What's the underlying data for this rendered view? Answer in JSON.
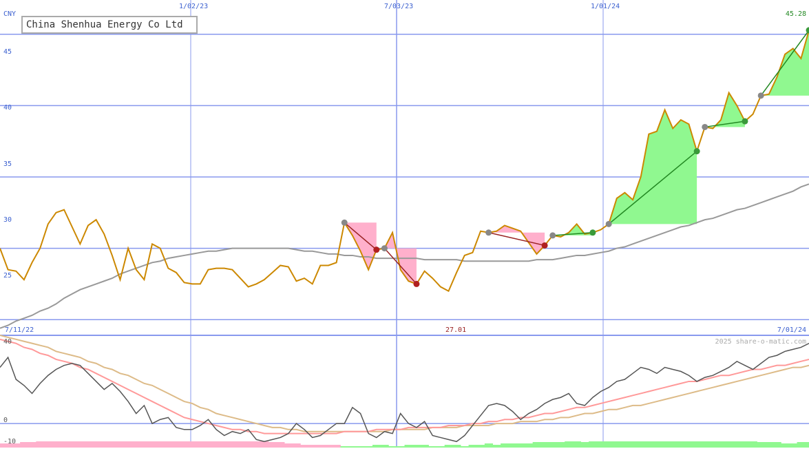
{
  "title": "China Shenhua Energy Co Ltd",
  "currency": "CNY",
  "last_price": "45.28",
  "mid_label": "27.01",
  "watermark": "2025 share-o-matic.com",
  "x_labels_top": [
    "1/02/23",
    "7/03/23",
    "1/01/24"
  ],
  "range_start": "7/11/22",
  "range_end": "7/01/24",
  "y_labels_price": [
    "45",
    "40",
    "35",
    "30",
    "25"
  ],
  "y_labels_osc": [
    "40",
    "0",
    "-10"
  ],
  "colors": {
    "price_line": "#cc8800",
    "moving_average": "#999999",
    "up_fill": "#90f890",
    "down_fill": "#ffb0cc",
    "gridline": "#8899ee",
    "up_trend": "#228822",
    "down_trend": "#992222",
    "osc_dark": "#555555",
    "osc_pink": "#ff9999",
    "osc_tan": "#ddbb88"
  },
  "chart_data": [
    {
      "type": "line",
      "title": "China Shenhua Energy Co Ltd",
      "ylabel": "CNY",
      "ylim": [
        23.9,
        47.4
      ],
      "x_ticks": [
        "1/02/23",
        "7/03/23",
        "1/01/24"
      ],
      "y_ticks": [
        25,
        30,
        35,
        40,
        45
      ],
      "grid": true,
      "series": [
        {
          "role": "price",
          "values": [
            30.0,
            28.5,
            28.4,
            27.8,
            29.0,
            30.0,
            31.7,
            32.5,
            32.7,
            31.5,
            30.3,
            31.6,
            32.0,
            31.0,
            29.5,
            27.8,
            30.0,
            28.5,
            27.8,
            30.3,
            30.0,
            28.6,
            28.3,
            27.6,
            27.5,
            27.5,
            28.5,
            28.6,
            28.6,
            28.5,
            27.9,
            27.3,
            27.5,
            27.8,
            28.3,
            28.8,
            28.7,
            27.7,
            27.9,
            27.5,
            28.8,
            28.8,
            29.0,
            31.8,
            30.9,
            29.8,
            28.5,
            29.9,
            30.0,
            31.1,
            28.5,
            27.7,
            27.5,
            28.4,
            27.9,
            27.3,
            27.0,
            28.3,
            29.5,
            29.7,
            31.2,
            31.1,
            31.2,
            31.6,
            31.4,
            31.2,
            30.4,
            29.6,
            30.2,
            30.9,
            30.8,
            31.1,
            31.7,
            31.0,
            31.1,
            31.3,
            31.7,
            33.5,
            33.9,
            33.4,
            35.0,
            38.0,
            38.2,
            39.7,
            38.4,
            39.0,
            38.7,
            36.8,
            38.5,
            38.4,
            39.0,
            40.9,
            40.0,
            38.9,
            39.4,
            40.7,
            40.8,
            42.0,
            43.6,
            44.0,
            43.3,
            45.28
          ]
        },
        {
          "role": "moving_average",
          "values": [
            24.4,
            24.6,
            24.9,
            25.1,
            25.3,
            25.6,
            25.8,
            26.1,
            26.5,
            26.8,
            27.1,
            27.3,
            27.5,
            27.7,
            27.9,
            28.2,
            28.4,
            28.6,
            28.8,
            29.0,
            29.1,
            29.3,
            29.4,
            29.5,
            29.6,
            29.7,
            29.8,
            29.8,
            29.9,
            30.0,
            30.0,
            30.0,
            30.0,
            30.0,
            30.0,
            30.0,
            30.0,
            29.9,
            29.8,
            29.8,
            29.7,
            29.6,
            29.6,
            29.5,
            29.5,
            29.4,
            29.4,
            29.3,
            29.3,
            29.3,
            29.3,
            29.3,
            29.3,
            29.2,
            29.2,
            29.2,
            29.2,
            29.2,
            29.1,
            29.1,
            29.1,
            29.1,
            29.1,
            29.1,
            29.1,
            29.1,
            29.1,
            29.2,
            29.2,
            29.2,
            29.3,
            29.4,
            29.5,
            29.5,
            29.6,
            29.7,
            29.8,
            30.0,
            30.1,
            30.3,
            30.5,
            30.7,
            30.9,
            31.1,
            31.3,
            31.5,
            31.6,
            31.8,
            32.0,
            32.1,
            32.3,
            32.5,
            32.7,
            32.8,
            33.0,
            33.2,
            33.4,
            33.6,
            33.8,
            34.0,
            34.3,
            34.5
          ]
        }
      ],
      "signals": [
        {
          "from": 43,
          "to": 47,
          "direction": "down"
        },
        {
          "from": 48,
          "to": 52,
          "direction": "down"
        },
        {
          "from": 61,
          "to": 68,
          "direction": "down"
        },
        {
          "from": 69,
          "to": 74,
          "direction": "up"
        },
        {
          "from": 76,
          "to": 87,
          "direction": "up"
        },
        {
          "from": 88,
          "to": 93,
          "direction": "up"
        },
        {
          "from": 95,
          "to": 101,
          "direction": "up"
        }
      ]
    },
    {
      "type": "line",
      "ylim": [
        -12,
        44
      ],
      "y_ticks": [
        40,
        0,
        -10
      ],
      "grid": true,
      "series": [
        {
          "role": "oscillator",
          "values": [
            28,
            33,
            22,
            19,
            15,
            20,
            24,
            27,
            29,
            30,
            29,
            25,
            21,
            17,
            20,
            16,
            11,
            5,
            9,
            0,
            2,
            3,
            -2,
            -3,
            -3,
            -1,
            2,
            -3,
            -6,
            -4,
            -5,
            -3,
            -8,
            -9,
            -8,
            -7,
            -5,
            0,
            -3,
            -7,
            -6,
            -3,
            0,
            0,
            8,
            5,
            -5,
            -7,
            -4,
            -5,
            5,
            0,
            -2,
            1,
            -6,
            -7,
            -8,
            -9,
            -6,
            -1,
            4,
            9,
            10,
            9,
            6,
            2,
            5,
            7,
            10,
            12,
            13,
            15,
            10,
            9,
            13,
            16,
            18,
            21,
            22,
            25,
            28,
            27,
            25,
            28,
            27,
            26,
            24,
            21,
            23,
            24,
            26,
            28,
            31,
            29,
            27,
            30,
            33,
            34,
            36,
            37,
            38,
            40
          ]
        },
        {
          "role": "signal_fast",
          "values": [
            42,
            41,
            40,
            38,
            37,
            35,
            34,
            32,
            31,
            30,
            28,
            27,
            25,
            23,
            21,
            19,
            17,
            15,
            13,
            11,
            9,
            7,
            5,
            3,
            2,
            1,
            0,
            -1,
            -2,
            -3,
            -3,
            -4,
            -4,
            -5,
            -5,
            -5,
            -5,
            -5,
            -5,
            -5,
            -5,
            -5,
            -5,
            -4,
            -4,
            -4,
            -4,
            -3,
            -3,
            -3,
            -3,
            -2,
            -2,
            -2,
            -2,
            -2,
            -1,
            -1,
            -1,
            0,
            0,
            1,
            1,
            2,
            2,
            3,
            3,
            4,
            5,
            5,
            6,
            7,
            8,
            8,
            9,
            10,
            11,
            12,
            13,
            14,
            15,
            16,
            17,
            18,
            19,
            20,
            21,
            21,
            22,
            23,
            24,
            24,
            25,
            26,
            27,
            27,
            28,
            29,
            29,
            30,
            31,
            32
          ]
        },
        {
          "role": "signal_slow",
          "values": [
            44,
            43,
            42,
            41,
            40,
            39,
            38,
            36,
            35,
            34,
            33,
            31,
            30,
            28,
            27,
            25,
            24,
            22,
            20,
            19,
            17,
            15,
            13,
            11,
            10,
            8,
            7,
            5,
            4,
            3,
            2,
            1,
            0,
            -1,
            -2,
            -2,
            -3,
            -3,
            -4,
            -4,
            -4,
            -4,
            -4,
            -4,
            -4,
            -4,
            -4,
            -4,
            -4,
            -3,
            -3,
            -3,
            -3,
            -3,
            -2,
            -2,
            -2,
            -2,
            -1,
            -1,
            -1,
            -1,
            0,
            0,
            0,
            1,
            1,
            1,
            2,
            2,
            3,
            3,
            4,
            5,
            5,
            6,
            7,
            7,
            8,
            9,
            9,
            10,
            11,
            12,
            13,
            14,
            15,
            16,
            17,
            18,
            19,
            20,
            21,
            22,
            23,
            24,
            25,
            26,
            27,
            28,
            28,
            29
          ]
        }
      ]
    }
  ]
}
